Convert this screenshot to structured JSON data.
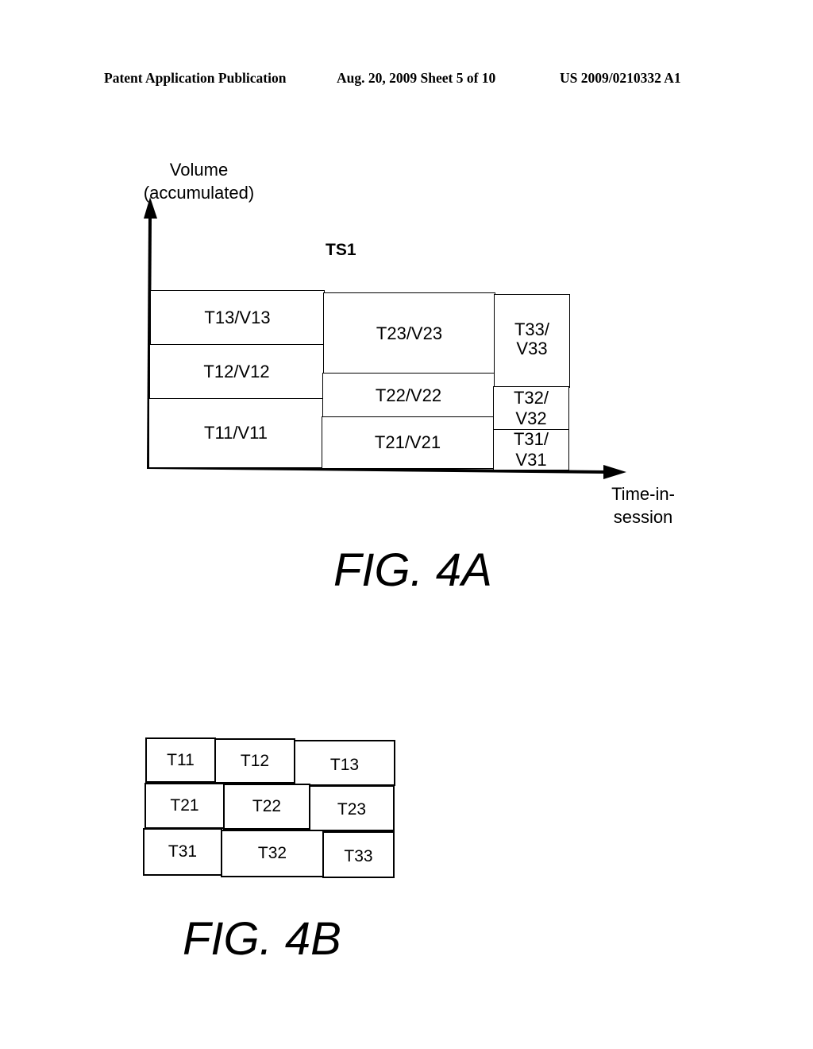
{
  "header": {
    "left": "Patent Application Publication",
    "middle": "Aug. 20, 2009  Sheet 5 of 10",
    "right": "US 2009/0210332 A1"
  },
  "fig4a": {
    "y_axis_label_line1": "Volume",
    "y_axis_label_line2": "(accumulated)",
    "x_axis_label_line1": "Time-in-",
    "x_axis_label_line2": "session",
    "stack_title": "TS1",
    "columns": [
      {
        "id": "col1",
        "cells": [
          {
            "id": "t11",
            "label": "T11/V11"
          },
          {
            "id": "t12",
            "label": "T12/V12"
          },
          {
            "id": "t13",
            "label": "T13/V13"
          }
        ]
      },
      {
        "id": "col2",
        "cells": [
          {
            "id": "t21",
            "label": "T21/V21"
          },
          {
            "id": "t22",
            "label": "T22/V22"
          },
          {
            "id": "t23",
            "label": "T23/V23"
          }
        ]
      },
      {
        "id": "col3",
        "cells": [
          {
            "id": "t31",
            "label_line1": "T31/",
            "label_line2": "V31"
          },
          {
            "id": "t32",
            "label_line1": "T32/",
            "label_line2": "V32"
          },
          {
            "id": "t33",
            "label_line1": "T33/",
            "label_line2": "V33"
          }
        ]
      }
    ],
    "caption": "FIG. 4A"
  },
  "fig4b": {
    "rows": [
      [
        "T11",
        "T12",
        "T13"
      ],
      [
        "T21",
        "T22",
        "T23"
      ],
      [
        "T31",
        "T32",
        "T33"
      ]
    ],
    "caption": "FIG. 4B"
  }
}
